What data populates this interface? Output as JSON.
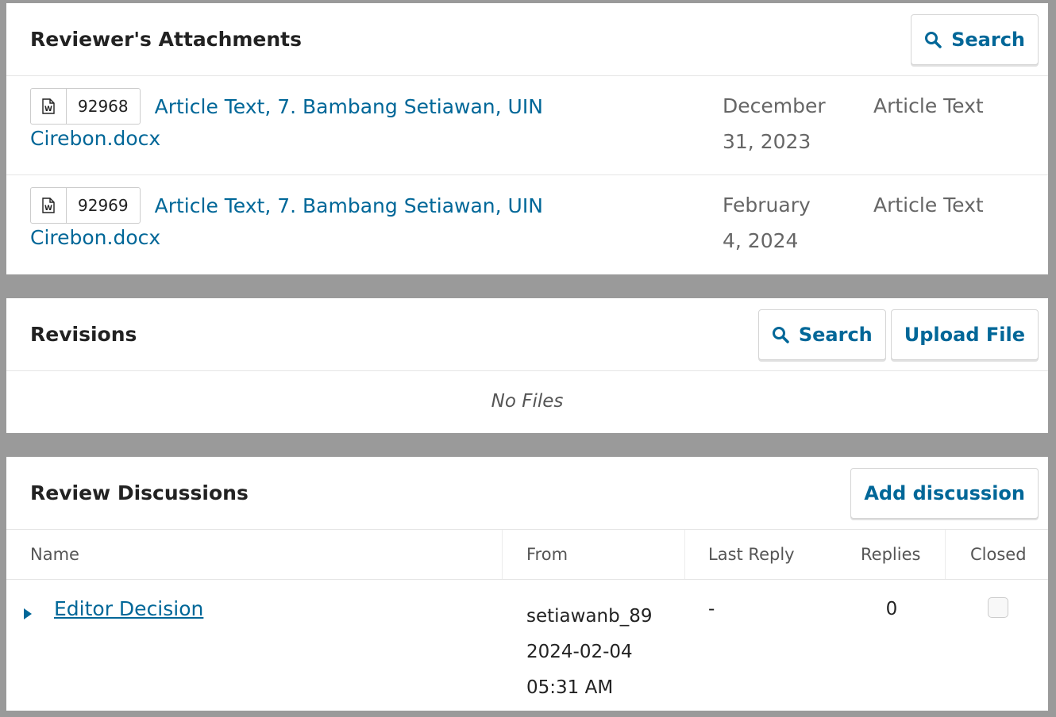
{
  "attachments": {
    "title": "Reviewer's Attachments",
    "search_label": "Search",
    "files": [
      {
        "id": "92968",
        "name_line1": "Article Text, 7. Bambang Setiawan, UIN",
        "name_line2": "Cirebon.docx",
        "date_line1": "December",
        "date_line2": "31, 2023",
        "type": "Article Text"
      },
      {
        "id": "92969",
        "name_line1": "Article Text, 7. Bambang Setiawan, UIN",
        "name_line2": "Cirebon.docx",
        "date_line1": "February",
        "date_line2": "4, 2024",
        "type": "Article Text"
      }
    ]
  },
  "revisions": {
    "title": "Revisions",
    "search_label": "Search",
    "upload_label": "Upload File",
    "empty": "No Files"
  },
  "discussions": {
    "title": "Review Discussions",
    "add_label": "Add discussion",
    "columns": {
      "name": "Name",
      "from": "From",
      "last_reply": "Last Reply",
      "replies": "Replies",
      "closed": "Closed"
    },
    "rows": [
      {
        "name": "Editor Decision",
        "from_user": "setiawanb_89",
        "from_date": "2024-02-04",
        "from_time": "05:31 AM",
        "last_reply": "-",
        "replies": "0"
      }
    ]
  },
  "icons": {
    "search": "search-icon",
    "file": "word-file-icon",
    "expand": "triangle-right-icon"
  },
  "colors": {
    "link": "#006798",
    "frame": "#9a9a9a"
  }
}
